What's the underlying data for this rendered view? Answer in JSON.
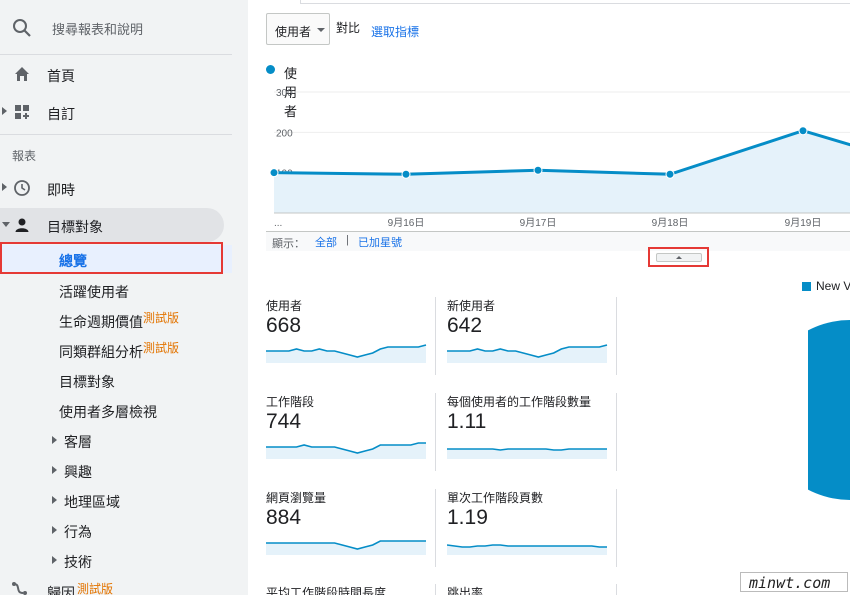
{
  "sidebar": {
    "search_placeholder": "搜尋報表和說明",
    "home": "首頁",
    "custom": "自訂",
    "section_reports": "報表",
    "realtime": "即時",
    "audience": "目標對象",
    "audience_items": [
      {
        "label": "總覽"
      },
      {
        "label": "活躍使用者"
      },
      {
        "label": "生命週期價值",
        "beta": "測試版"
      },
      {
        "label": "同類群組分析",
        "beta": "測試版"
      },
      {
        "label": "目標對象"
      },
      {
        "label": "使用者多層檢視"
      }
    ],
    "audience_groups": [
      "客層",
      "興趣",
      "地理區域",
      "行為",
      "技術"
    ],
    "attribution": "歸因",
    "attribution_beta": "測試版"
  },
  "toolbar": {
    "metric_select": "使用者",
    "compare_label": "對比",
    "choose_metric": "選取指標"
  },
  "chart": {
    "legend": "使用者",
    "footer_show": "顯示：",
    "footer_all": "全部",
    "footer_sep": "|",
    "footer_starred": "已加星號"
  },
  "chart_data": {
    "type": "area",
    "series": [
      {
        "name": "使用者",
        "color": "#058dc7",
        "values": [
          100,
          96,
          106,
          96,
          204,
          156
        ]
      }
    ],
    "x": [
      "...",
      "9月16日",
      "9月17日",
      "9月18日",
      "9月19日",
      ""
    ],
    "yticks": [
      100,
      200,
      300
    ],
    "ylim": [
      0,
      300
    ]
  },
  "cards": [
    {
      "title": "使用者",
      "value": "668",
      "spark": [
        5,
        5,
        5,
        5,
        6,
        5,
        5,
        6,
        5,
        5,
        4,
        3,
        2,
        3,
        4,
        6,
        7,
        7,
        7,
        7,
        7,
        8
      ],
      "fill_level": 0.25
    },
    {
      "title": "新使用者",
      "value": "642",
      "spark": [
        5,
        5,
        5,
        5,
        6,
        5,
        5,
        6,
        5,
        5,
        4,
        3,
        2,
        3,
        4,
        6,
        7,
        7,
        7,
        7,
        7,
        8
      ],
      "fill_level": 0.25
    },
    {
      "title": "工作階段",
      "value": "744",
      "spark": [
        5,
        5,
        5,
        5,
        5,
        6,
        5,
        5,
        5,
        5,
        4,
        3,
        2,
        3,
        4,
        6,
        6,
        6,
        6,
        6,
        7,
        7
      ],
      "fill_level": 0.25
    },
    {
      "title": "每個使用者的工作階段數量",
      "value": "1.11",
      "spark": [
        4,
        4,
        4,
        4,
        4,
        4,
        4,
        3.5,
        4,
        4,
        4,
        4,
        4,
        4,
        3.5,
        3.5,
        4,
        4,
        4,
        4,
        4,
        4
      ],
      "fill_level": 0.4
    },
    {
      "title": "網頁瀏覽量",
      "value": "884",
      "spark": [
        5,
        5,
        5,
        5,
        5,
        5,
        5,
        5,
        5,
        5,
        4,
        3,
        2,
        3,
        4,
        6,
        6,
        6,
        6,
        6,
        6,
        6
      ],
      "fill_level": 0.25
    },
    {
      "title": "單次工作階段頁數",
      "value": "1.19",
      "spark": [
        4,
        3.5,
        3,
        3,
        3.5,
        3.5,
        4,
        4,
        3.5,
        3.5,
        3.5,
        3.5,
        3.5,
        3.5,
        3.5,
        3.5,
        3.5,
        3.5,
        3.5,
        3.5,
        3,
        3
      ],
      "fill_level": 0.4
    },
    {
      "title": "平均工作階段時間長度",
      "value": ""
    },
    {
      "title": "跳出率",
      "value": ""
    }
  ],
  "pie": {
    "legend": "New V",
    "color": "#058dc7"
  },
  "watermark": "minwt.com",
  "colors": {
    "accent": "#058dc7",
    "link": "#1a73e8",
    "highlight": "#e53935",
    "beta": "#e37400"
  }
}
